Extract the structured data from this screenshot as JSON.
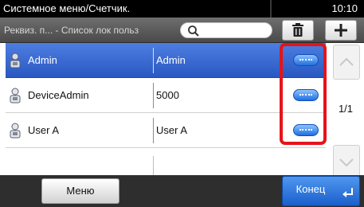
{
  "header": {
    "title": "Системное меню/Счетчик.",
    "time": "10:10"
  },
  "subheader": {
    "breadcrumb": "Реквиз. п... - Список лок польз",
    "search_placeholder": "",
    "icons": [
      "search-icon",
      "trash-icon",
      "plus-icon"
    ]
  },
  "users": [
    {
      "name": "Admin",
      "password": "Admin",
      "selected": true
    },
    {
      "name": "DeviceAdmin",
      "password": "5000",
      "selected": false
    },
    {
      "name": "User A",
      "password": "User A",
      "selected": false
    }
  ],
  "pagination": {
    "indicator": "1/1"
  },
  "footer": {
    "menu_label": "Меню",
    "end_label": "Конец"
  },
  "colors": {
    "selected_row": "#2f5fc8",
    "highlight": "#e4141a",
    "detail_button": "#1f6fe0"
  }
}
